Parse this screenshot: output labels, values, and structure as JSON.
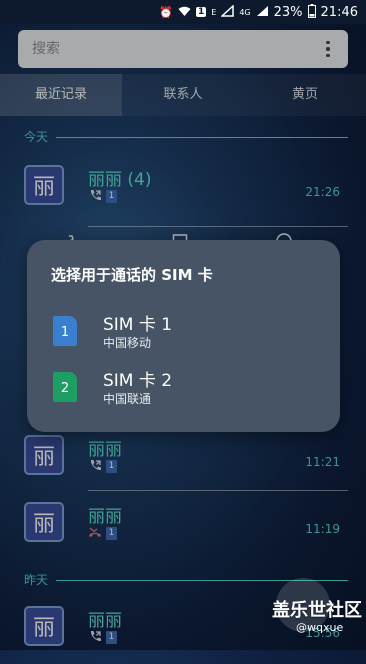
{
  "status_bar": {
    "battery": "23%",
    "time": "21:46",
    "network": "4G",
    "sim_badge": "1",
    "e_label": "E"
  },
  "search": {
    "placeholder": "搜索"
  },
  "tabs": [
    {
      "label": "最近记录",
      "active": true
    },
    {
      "label": "联系人",
      "active": false
    },
    {
      "label": "黄页",
      "active": false
    }
  ],
  "sections": {
    "today": "今天",
    "yesterday": "昨天"
  },
  "calls": [
    {
      "name": "丽丽 (4)",
      "avatar": "丽",
      "sim": "1",
      "time": "21:26",
      "type": "outgoing"
    },
    {
      "name": "丽丽",
      "avatar": "丽",
      "sim": "1",
      "time": "11:21",
      "type": "outgoing"
    },
    {
      "name": "丽丽",
      "avatar": "丽",
      "sim": "1",
      "time": "11:19",
      "type": "missed"
    },
    {
      "name": "丽丽",
      "avatar": "丽",
      "sim": "1",
      "time": "15:56",
      "type": "outgoing"
    }
  ],
  "dialog": {
    "title": "选择用于通话的 SIM 卡",
    "options": [
      {
        "name": "SIM 卡 1",
        "carrier": "中国移动",
        "badge": "1",
        "color": "#3b7fd0"
      },
      {
        "name": "SIM 卡 2",
        "carrier": "中国联通",
        "badge": "2",
        "color": "#1e9e62"
      }
    ]
  },
  "watermark": {
    "title": "盖乐世社区",
    "author": "@wqxue"
  },
  "colors": {
    "accent": "#4fd0c9",
    "dialog_bg": "#465465",
    "avatar_bg": "#3a4e9b"
  }
}
